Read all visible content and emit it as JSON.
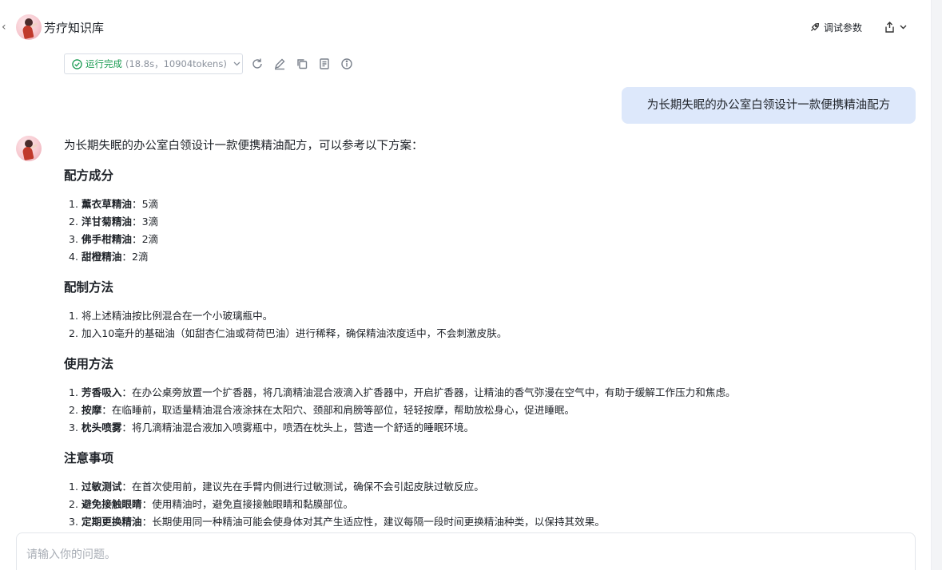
{
  "header": {
    "back_label": "‹",
    "title": "芳疗知识库",
    "debug_label": "调试参数"
  },
  "run_status": {
    "status": "运行完成",
    "meta": "(18.8s，10904tokens)"
  },
  "user_message": "为长期失眠的办公室白领设计一款便携精油配方",
  "answer": {
    "intro": "为长期失眠的办公室白领设计一款便携精油配方，可以参考以下方案：",
    "sections": [
      {
        "title": "配方成分",
        "items": [
          {
            "num": "1.",
            "bold": "薰衣草精油",
            "text": "：5滴"
          },
          {
            "num": "2.",
            "bold": "洋甘菊精油",
            "text": "：3滴"
          },
          {
            "num": "3.",
            "bold": "佛手柑精油",
            "text": "：2滴"
          },
          {
            "num": "4.",
            "bold": "甜橙精油",
            "text": "：2滴"
          }
        ]
      },
      {
        "title": "配制方法",
        "items": [
          {
            "num": "1.",
            "bold": "",
            "text": "将上述精油按比例混合在一个小玻璃瓶中。"
          },
          {
            "num": "2.",
            "bold": "",
            "text": "加入10毫升的基础油（如甜杏仁油或荷荷巴油）进行稀释，确保精油浓度适中，不会刺激皮肤。"
          }
        ]
      },
      {
        "title": "使用方法",
        "items": [
          {
            "num": "1.",
            "bold": "芳香吸入",
            "text": "：在办公桌旁放置一个扩香器，将几滴精油混合液滴入扩香器中，开启扩香器，让精油的香气弥漫在空气中，有助于缓解工作压力和焦虑。"
          },
          {
            "num": "2.",
            "bold": "按摩",
            "text": "：在临睡前，取适量精油混合液涂抹在太阳穴、颈部和肩膀等部位，轻轻按摩，帮助放松身心，促进睡眠。"
          },
          {
            "num": "3.",
            "bold": "枕头喷雾",
            "text": "：将几滴精油混合液加入喷雾瓶中，喷洒在枕头上，营造一个舒适的睡眠环境。"
          }
        ]
      },
      {
        "title": "注意事项",
        "items": [
          {
            "num": "1.",
            "bold": "过敏测试",
            "text": "：在首次使用前，建议先在手臂内侧进行过敏测试，确保不会引起皮肤过敏反应。"
          },
          {
            "num": "2.",
            "bold": "避免接触眼睛",
            "text": "：使用精油时，避免直接接触眼睛和黏膜部位。"
          },
          {
            "num": "3.",
            "bold": "定期更换精油",
            "text": "：长期使用同一种精油可能会使身体对其产生适应性，建议每隔一段时间更换精油种类，以保持其效果。"
          }
        ]
      }
    ]
  },
  "input": {
    "placeholder": "请输入你的问题。"
  },
  "colors": {
    "status_green": "#1a9b52",
    "user_bubble": "#dde8fb"
  },
  "icons": [
    "chevron-left-icon",
    "avatar",
    "rocket-icon",
    "share-icon",
    "chevron-down-icon",
    "check-circle-icon",
    "refresh-icon",
    "edit-icon",
    "copy-icon",
    "notes-icon",
    "info-icon"
  ]
}
